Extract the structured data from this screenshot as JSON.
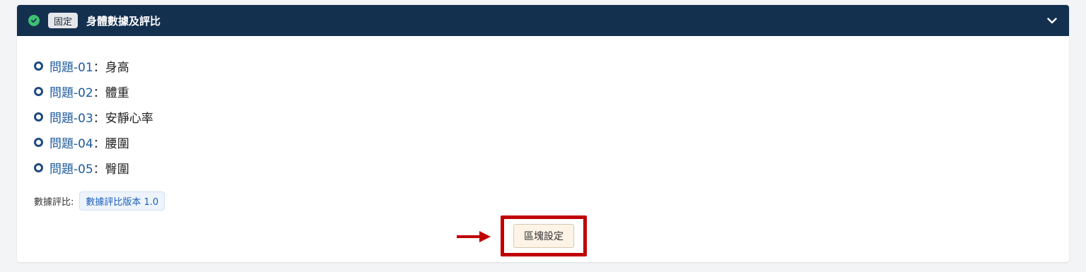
{
  "header": {
    "badge": "固定",
    "title": "身體數據及評比"
  },
  "questions": [
    {
      "id": "問題-01",
      "text": "身高"
    },
    {
      "id": "問題-02",
      "text": "體重"
    },
    {
      "id": "問題-03",
      "text": "安靜心率"
    },
    {
      "id": "問題-04",
      "text": "腰圍"
    },
    {
      "id": "問題-05",
      "text": "臀圍"
    }
  ],
  "colon": "：",
  "evaluation": {
    "label": "數據評比:",
    "tag": "數據評比版本 1.0"
  },
  "block_button_label": "區塊設定",
  "colors": {
    "header_bg": "#14304f",
    "check": "#3fbf74",
    "link": "#1d5a9b",
    "highlight": "#c00000"
  }
}
